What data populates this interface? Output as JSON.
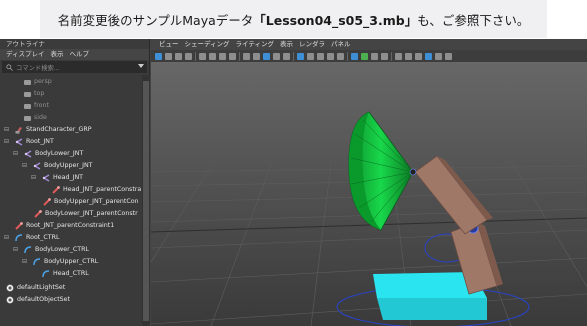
{
  "caption": {
    "prefix": "名前変更後のサンプルMayaデータ",
    "file": "「Lesson04_s05_3.mb」",
    "suffix": "も、ご参照下さい。"
  },
  "outliner": {
    "title": "アウトライナ",
    "menu": [
      "ディスプレイ",
      "表示",
      "ヘルプ"
    ],
    "search_placeholder": "コマンド検索...",
    "items": [
      {
        "label": "persp",
        "type": "camera"
      },
      {
        "label": "top",
        "type": "camera"
      },
      {
        "label": "front",
        "type": "camera"
      },
      {
        "label": "side",
        "type": "camera"
      },
      {
        "label": "StandCharacter_GRP",
        "type": "group"
      },
      {
        "label": "Root_JNT",
        "type": "joint"
      },
      {
        "label": "BodyLower_JNT",
        "type": "joint"
      },
      {
        "label": "BodyUpper_JNT",
        "type": "joint"
      },
      {
        "label": "Head_JNT",
        "type": "joint"
      },
      {
        "label": "Head_JNT_parentConstra",
        "type": "constraint"
      },
      {
        "label": "BodyUpper_JNT_parentCon",
        "type": "constraint"
      },
      {
        "label": "BodyLower_JNT_parentConstr",
        "type": "constraint"
      },
      {
        "label": "Root_JNT_parentConstraint1",
        "type": "constraint"
      },
      {
        "label": "Root_CTRL",
        "type": "curve"
      },
      {
        "label": "BodyLower_CTRL",
        "type": "curve"
      },
      {
        "label": "BodyUpper_CTRL",
        "type": "curve"
      },
      {
        "label": "Head_CTRL",
        "type": "curve"
      },
      {
        "label": "defaultLightSet",
        "type": "set"
      },
      {
        "label": "defaultObjectSet",
        "type": "set"
      }
    ]
  },
  "viewport": {
    "menu": [
      "ビュー",
      "シェーディング",
      "ライティング",
      "表示",
      "レンダラ",
      "パネル"
    ]
  },
  "colors": {
    "cone": "#12c23c",
    "base": "#29d8e6",
    "arm": "#a07868",
    "joint_icon": "#a78bd8",
    "curve_icon": "#4aa3e8",
    "constraint_icon": "#e05a5a"
  }
}
